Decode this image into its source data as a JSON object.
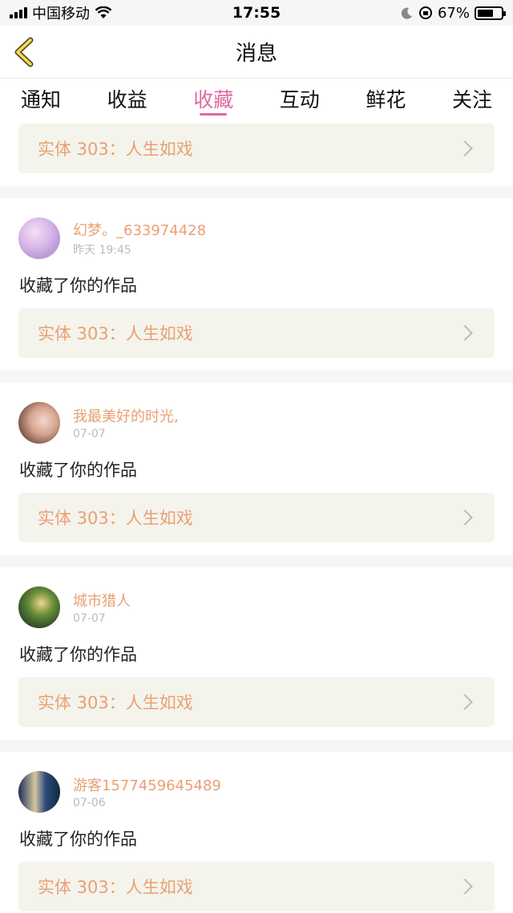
{
  "status_bar": {
    "carrier": "中国移动",
    "time": "17:55",
    "battery": "67%"
  },
  "nav": {
    "title": "消息"
  },
  "tabs": [
    {
      "label": "通知"
    },
    {
      "label": "收益"
    },
    {
      "label": "收藏"
    },
    {
      "label": "互动"
    },
    {
      "label": "鲜花"
    },
    {
      "label": "关注"
    }
  ],
  "active_tab": "收藏",
  "first_card": {
    "work": "实体 303：人生如戏"
  },
  "items": [
    {
      "user": "幻梦。_633974428",
      "time": "昨天 19:45",
      "action": "收藏了你的作品",
      "work": "实体 303：人生如戏"
    },
    {
      "user": "我最美好的时光,",
      "time": "07-07",
      "action": "收藏了你的作品",
      "work": "实体 303：人生如戏"
    },
    {
      "user": "城市猎人",
      "time": "07-07",
      "action": "收藏了你的作品",
      "work": "实体 303：人生如戏"
    },
    {
      "user": "游客1577459645489",
      "time": "07-06",
      "action": "收藏了你的作品",
      "work": "实体 303：人生如戏"
    }
  ],
  "colors": {
    "accent": "#e06aa3",
    "username": "#e9a074",
    "card_bg": "#f4f4ec"
  }
}
